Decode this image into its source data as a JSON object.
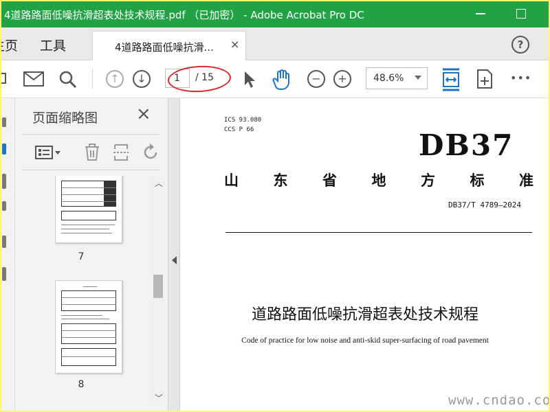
{
  "window": {
    "title": "4道路路面低噪抗滑超表处技术规程.pdf （已加密） - Adobe Acrobat Pro DC"
  },
  "tabs": {
    "home": "主页",
    "tools": "工具",
    "document": "4道路路面低噪抗滑...",
    "close": "×",
    "help": "?"
  },
  "toolbar": {
    "page_current": "1",
    "page_total": "/ 15",
    "zoom": "48.6%",
    "more": "•••"
  },
  "thumbnail_panel": {
    "title": "页面缩略图",
    "close": "×",
    "pages": [
      {
        "number": "7"
      },
      {
        "number": "8"
      }
    ]
  },
  "document": {
    "ics": "ICS  93.080",
    "ccs": "CCS  P  66",
    "logo": "DB37",
    "province_chars": [
      "山",
      "东",
      "省",
      "地",
      "方",
      "标",
      "准"
    ],
    "standard_no": "DB37/T 4789—2024",
    "title_cn": "道路路面低噪抗滑超表处技术规程",
    "title_en": "Code of practice for low noise and anti-skid super-surfacing of road pavement"
  },
  "watermark": "www.cndao.com",
  "colors": {
    "titlebar": "#21a345",
    "accent_blue": "#1a73c8",
    "annotation_red": "#d9262b",
    "frame": "#fdf86b"
  }
}
